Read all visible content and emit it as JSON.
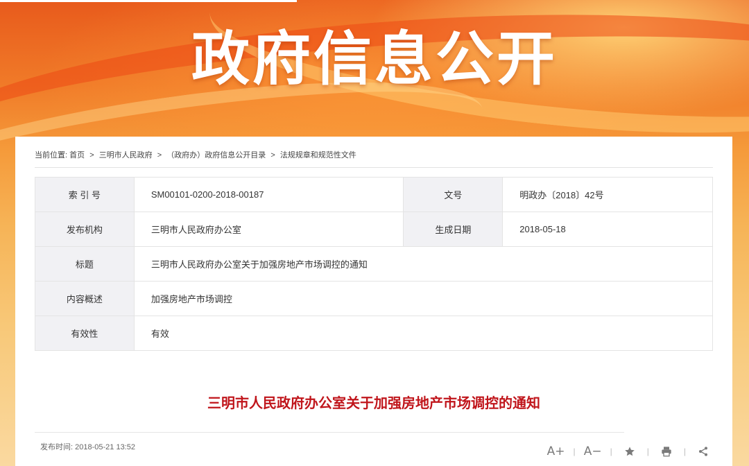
{
  "banner": {
    "title": "政府信息公开"
  },
  "breadcrumb": {
    "prefix": "当前位置:",
    "items": [
      "首页",
      "三明市人民政府",
      "（政府办）政府信息公开目录",
      "法规规章和规范性文件"
    ],
    "separator": ">"
  },
  "meta": {
    "index_label": "索 引 号",
    "index_value": "SM00101-0200-2018-00187",
    "docno_label": "文号",
    "docno_value": "明政办〔2018〕42号",
    "publisher_label": "发布机构",
    "publisher_value": "三明市人民政府办公室",
    "date_label": "生成日期",
    "date_value": "2018-05-18",
    "title_label": "标题",
    "title_value": "三明市人民政府办公室关于加强房地产市场调控的通知",
    "summary_label": "内容概述",
    "summary_value": "加强房地产市场调控",
    "validity_label": "有效性",
    "validity_value": "有效"
  },
  "document": {
    "title": "三明市人民政府办公室关于加强房地产市场调控的通知",
    "publish_time_label": "发布时间:",
    "publish_time": "2018-05-21 13:52"
  },
  "tools": {
    "font_increase": "A+",
    "font_decrease": "A−",
    "separator": "|"
  },
  "colors": {
    "title_red": "#c0151b",
    "banner_orange": "#f07a28"
  },
  "icons": [
    "star-icon",
    "print-icon",
    "share-icon"
  ]
}
